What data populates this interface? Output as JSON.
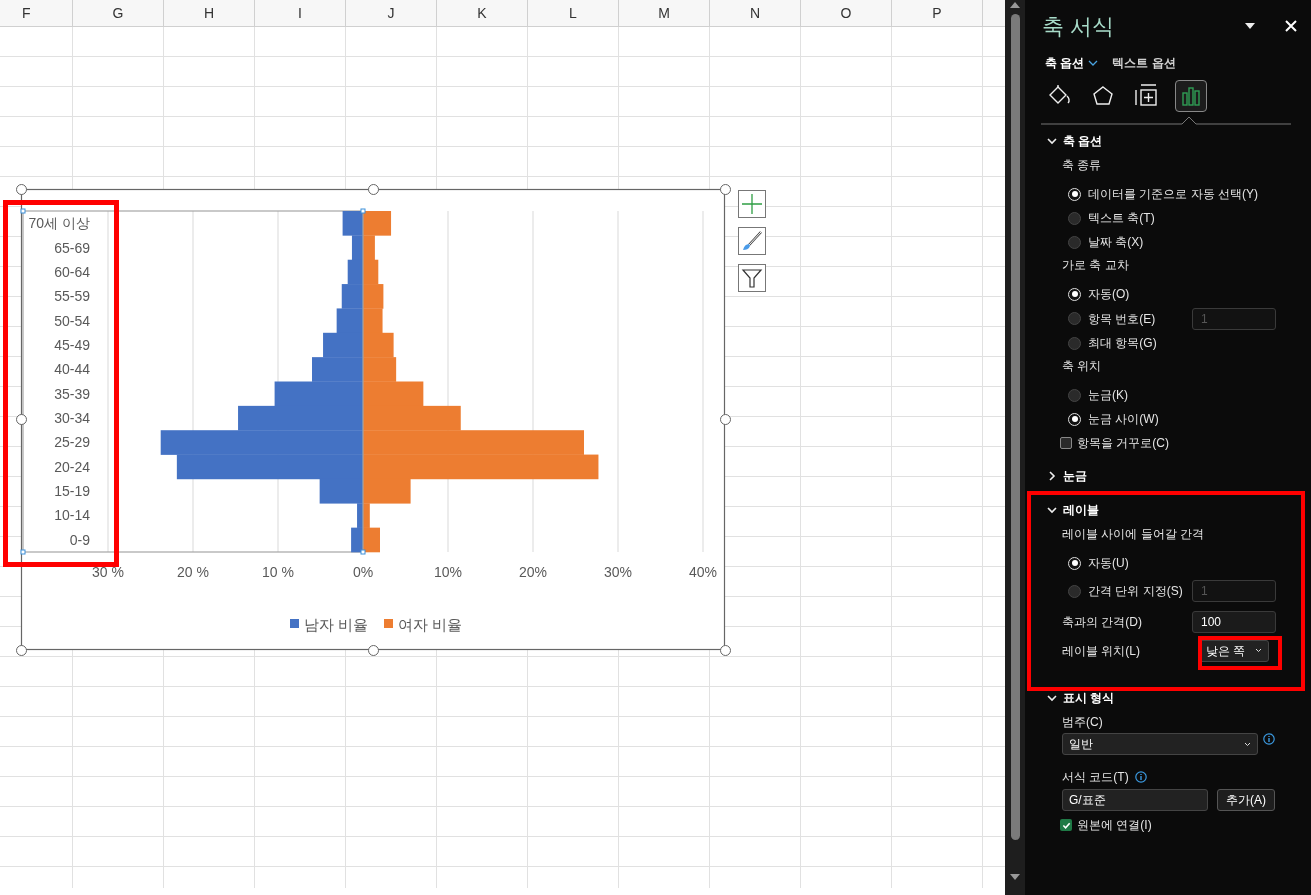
{
  "sheet": {
    "columns": [
      "F",
      "G",
      "H",
      "I",
      "J",
      "K",
      "L",
      "M",
      "N",
      "O",
      "P"
    ]
  },
  "chart": {
    "chart_data": {
      "type": "bar",
      "orientation": "horizontal",
      "stacked": true,
      "categories": [
        "70세 이상",
        "65-69",
        "60-64",
        "55-59",
        "50-54",
        "45-49",
        "40-44",
        "35-39",
        "30-34",
        "25-29",
        "20-24",
        "15-19",
        "10-14",
        "0-9"
      ],
      "series": [
        {
          "name": "남자 비율",
          "color": "#4472c4",
          "values": [
            -2.4,
            -1.3,
            -1.8,
            -2.5,
            -3.1,
            -4.7,
            -6.0,
            -10.4,
            -14.7,
            -23.8,
            -21.9,
            -5.1,
            -0.7,
            -1.4
          ]
        },
        {
          "name": "여자 비율",
          "color": "#ed7d31",
          "values": [
            3.3,
            1.4,
            1.8,
            2.4,
            2.3,
            3.6,
            3.9,
            7.1,
            11.5,
            26.0,
            27.7,
            5.6,
            0.8,
            2.0
          ]
        }
      ],
      "xlim": [
        -40,
        40
      ],
      "grid": true,
      "legend": true,
      "xticks": [
        {
          "value": -30,
          "label": "30 %"
        },
        {
          "value": -20,
          "label": "20 %"
        },
        {
          "value": -10,
          "label": "10 %"
        },
        {
          "value": 0,
          "label": "0%"
        },
        {
          "value": 10,
          "label": "10%"
        },
        {
          "value": 20,
          "label": "20%"
        },
        {
          "value": 30,
          "label": "30%"
        },
        {
          "value": 40,
          "label": "40%"
        }
      ]
    }
  },
  "panel": {
    "title": "축 서식",
    "tabs": [
      {
        "label": "축 옵션",
        "selected": true
      },
      {
        "label": "텍스트 옵션",
        "selected": false
      }
    ],
    "icon_tabs": [
      {
        "kind": "fill",
        "selected": false
      },
      {
        "kind": "effects",
        "selected": false
      },
      {
        "kind": "size",
        "selected": false
      },
      {
        "kind": "options",
        "selected": true
      }
    ],
    "sections": [
      {
        "title": "축 옵션",
        "expanded": true,
        "items": [
          {
            "kind": "heading",
            "label": "축 종류"
          },
          {
            "kind": "radio",
            "label": "데이터를 기준으로 자동 선택(Y)",
            "selected": true
          },
          {
            "kind": "radio",
            "label": "텍스트 축(T)",
            "selected": false
          },
          {
            "kind": "radio",
            "label": "날짜 축(X)",
            "selected": false
          },
          {
            "kind": "heading",
            "label": "가로 축 교차"
          },
          {
            "kind": "radio",
            "label": "자동(O)",
            "selected": true
          },
          {
            "kind": "radio",
            "label": "항목 번호(E)",
            "selected": false,
            "input": {
              "value": "1",
              "disabled": true
            }
          },
          {
            "kind": "radio",
            "label": "최대 항목(G)",
            "selected": false
          },
          {
            "kind": "heading",
            "label": "축 위치"
          },
          {
            "kind": "radio",
            "label": "눈금(K)",
            "selected": false
          },
          {
            "kind": "radio",
            "label": "눈금 사이(W)",
            "selected": true
          },
          {
            "kind": "checkbox",
            "label": "항목을 거꾸로(C)",
            "checked": false
          }
        ]
      },
      {
        "title": "눈금",
        "expanded": false
      },
      {
        "title": "레이블",
        "expanded": true,
        "items": [
          {
            "kind": "heading",
            "label": "레이블 사이에 들어갈 간격"
          },
          {
            "kind": "radio",
            "label": "자동(U)",
            "selected": true
          },
          {
            "kind": "radio",
            "label": "간격 단위 지정(S)",
            "selected": false,
            "input": {
              "value": "1",
              "disabled": true
            }
          },
          {
            "kind": "inline_field",
            "label": "축과의 간격(D)",
            "value": "100"
          },
          {
            "kind": "inline_select",
            "label": "레이블 위치(L)",
            "value": "낮은 쪽"
          }
        ]
      },
      {
        "title": "표시 형식",
        "expanded": true,
        "items": [
          {
            "kind": "stacked_select",
            "label": "범주(C)",
            "value": "일반"
          },
          {
            "kind": "stacked_field",
            "label": "서식 코드(T)",
            "value": "G/표준",
            "button": "추가(A)"
          },
          {
            "kind": "checkbox",
            "label": "원본에 연결(I)",
            "checked": true
          }
        ]
      }
    ]
  }
}
